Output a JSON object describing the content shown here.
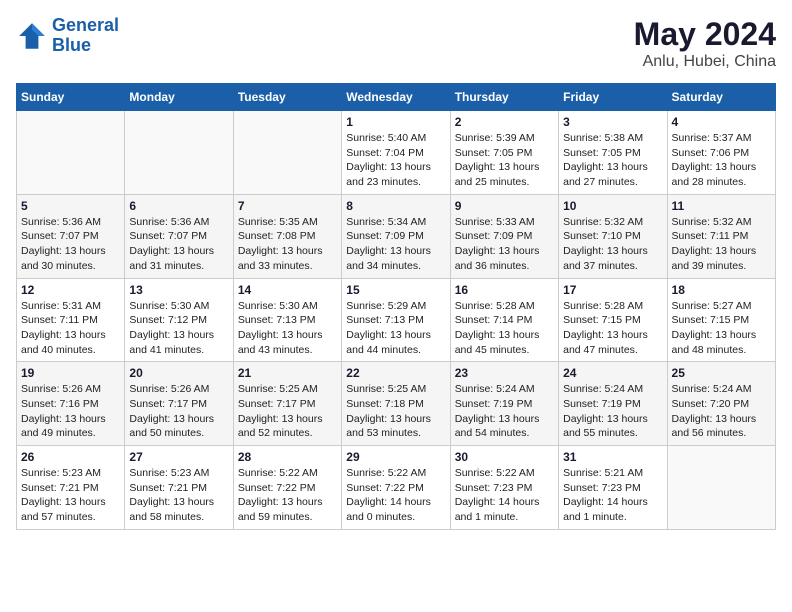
{
  "header": {
    "logo_general": "General",
    "logo_blue": "Blue",
    "month": "May 2024",
    "location": "Anlu, Hubei, China"
  },
  "weekdays": [
    "Sunday",
    "Monday",
    "Tuesday",
    "Wednesday",
    "Thursday",
    "Friday",
    "Saturday"
  ],
  "weeks": [
    [
      {
        "day": "",
        "info": ""
      },
      {
        "day": "",
        "info": ""
      },
      {
        "day": "",
        "info": ""
      },
      {
        "day": "1",
        "info": "Sunrise: 5:40 AM\nSunset: 7:04 PM\nDaylight: 13 hours\nand 23 minutes."
      },
      {
        "day": "2",
        "info": "Sunrise: 5:39 AM\nSunset: 7:05 PM\nDaylight: 13 hours\nand 25 minutes."
      },
      {
        "day": "3",
        "info": "Sunrise: 5:38 AM\nSunset: 7:05 PM\nDaylight: 13 hours\nand 27 minutes."
      },
      {
        "day": "4",
        "info": "Sunrise: 5:37 AM\nSunset: 7:06 PM\nDaylight: 13 hours\nand 28 minutes."
      }
    ],
    [
      {
        "day": "5",
        "info": "Sunrise: 5:36 AM\nSunset: 7:07 PM\nDaylight: 13 hours\nand 30 minutes."
      },
      {
        "day": "6",
        "info": "Sunrise: 5:36 AM\nSunset: 7:07 PM\nDaylight: 13 hours\nand 31 minutes."
      },
      {
        "day": "7",
        "info": "Sunrise: 5:35 AM\nSunset: 7:08 PM\nDaylight: 13 hours\nand 33 minutes."
      },
      {
        "day": "8",
        "info": "Sunrise: 5:34 AM\nSunset: 7:09 PM\nDaylight: 13 hours\nand 34 minutes."
      },
      {
        "day": "9",
        "info": "Sunrise: 5:33 AM\nSunset: 7:09 PM\nDaylight: 13 hours\nand 36 minutes."
      },
      {
        "day": "10",
        "info": "Sunrise: 5:32 AM\nSunset: 7:10 PM\nDaylight: 13 hours\nand 37 minutes."
      },
      {
        "day": "11",
        "info": "Sunrise: 5:32 AM\nSunset: 7:11 PM\nDaylight: 13 hours\nand 39 minutes."
      }
    ],
    [
      {
        "day": "12",
        "info": "Sunrise: 5:31 AM\nSunset: 7:11 PM\nDaylight: 13 hours\nand 40 minutes."
      },
      {
        "day": "13",
        "info": "Sunrise: 5:30 AM\nSunset: 7:12 PM\nDaylight: 13 hours\nand 41 minutes."
      },
      {
        "day": "14",
        "info": "Sunrise: 5:30 AM\nSunset: 7:13 PM\nDaylight: 13 hours\nand 43 minutes."
      },
      {
        "day": "15",
        "info": "Sunrise: 5:29 AM\nSunset: 7:13 PM\nDaylight: 13 hours\nand 44 minutes."
      },
      {
        "day": "16",
        "info": "Sunrise: 5:28 AM\nSunset: 7:14 PM\nDaylight: 13 hours\nand 45 minutes."
      },
      {
        "day": "17",
        "info": "Sunrise: 5:28 AM\nSunset: 7:15 PM\nDaylight: 13 hours\nand 47 minutes."
      },
      {
        "day": "18",
        "info": "Sunrise: 5:27 AM\nSunset: 7:15 PM\nDaylight: 13 hours\nand 48 minutes."
      }
    ],
    [
      {
        "day": "19",
        "info": "Sunrise: 5:26 AM\nSunset: 7:16 PM\nDaylight: 13 hours\nand 49 minutes."
      },
      {
        "day": "20",
        "info": "Sunrise: 5:26 AM\nSunset: 7:17 PM\nDaylight: 13 hours\nand 50 minutes."
      },
      {
        "day": "21",
        "info": "Sunrise: 5:25 AM\nSunset: 7:17 PM\nDaylight: 13 hours\nand 52 minutes."
      },
      {
        "day": "22",
        "info": "Sunrise: 5:25 AM\nSunset: 7:18 PM\nDaylight: 13 hours\nand 53 minutes."
      },
      {
        "day": "23",
        "info": "Sunrise: 5:24 AM\nSunset: 7:19 PM\nDaylight: 13 hours\nand 54 minutes."
      },
      {
        "day": "24",
        "info": "Sunrise: 5:24 AM\nSunset: 7:19 PM\nDaylight: 13 hours\nand 55 minutes."
      },
      {
        "day": "25",
        "info": "Sunrise: 5:24 AM\nSunset: 7:20 PM\nDaylight: 13 hours\nand 56 minutes."
      }
    ],
    [
      {
        "day": "26",
        "info": "Sunrise: 5:23 AM\nSunset: 7:21 PM\nDaylight: 13 hours\nand 57 minutes."
      },
      {
        "day": "27",
        "info": "Sunrise: 5:23 AM\nSunset: 7:21 PM\nDaylight: 13 hours\nand 58 minutes."
      },
      {
        "day": "28",
        "info": "Sunrise: 5:22 AM\nSunset: 7:22 PM\nDaylight: 13 hours\nand 59 minutes."
      },
      {
        "day": "29",
        "info": "Sunrise: 5:22 AM\nSunset: 7:22 PM\nDaylight: 14 hours\nand 0 minutes."
      },
      {
        "day": "30",
        "info": "Sunrise: 5:22 AM\nSunset: 7:23 PM\nDaylight: 14 hours\nand 1 minute."
      },
      {
        "day": "31",
        "info": "Sunrise: 5:21 AM\nSunset: 7:23 PM\nDaylight: 14 hours\nand 1 minute."
      },
      {
        "day": "",
        "info": ""
      }
    ]
  ]
}
